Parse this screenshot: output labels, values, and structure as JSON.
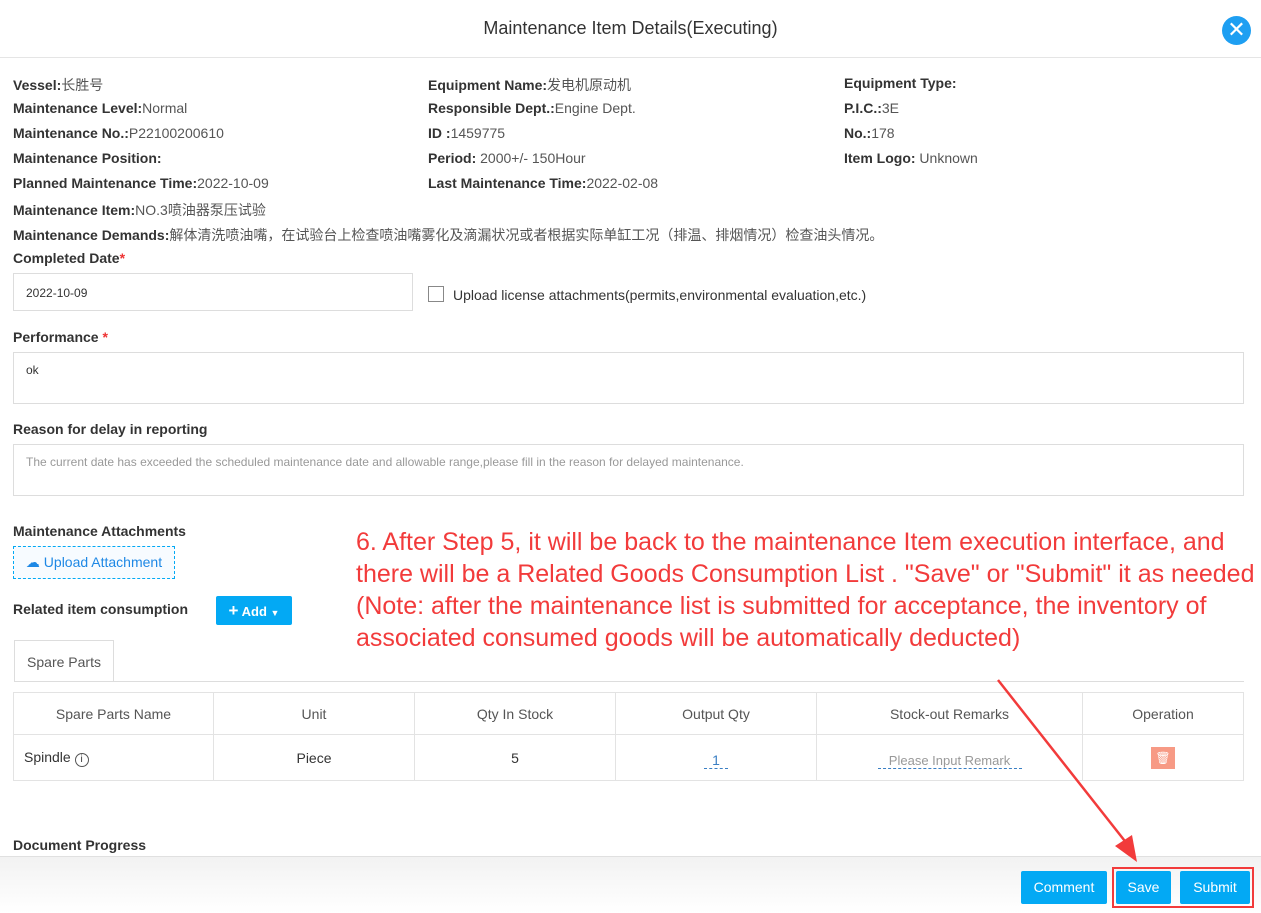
{
  "header": {
    "title": "Maintenance Item Details(Executing)",
    "close_icon": "close-icon"
  },
  "info": [
    {
      "label": "Vessel:",
      "value": "长胜号"
    },
    {
      "label": "Equipment Name:",
      "value": "发电机原动机"
    },
    {
      "label": "Equipment Type:",
      "value": ""
    },
    {
      "label": "Maintenance Level:",
      "value": "Normal"
    },
    {
      "label": "Responsible Dept.:",
      "value": "Engine Dept."
    },
    {
      "label": "P.I.C.:",
      "value": "3E"
    },
    {
      "label": "Maintenance No.:",
      "value": "P22100200610"
    },
    {
      "label": "ID :",
      "value": "1459775"
    },
    {
      "label": "No.:",
      "value": "178"
    },
    {
      "label": "Maintenance Position:",
      "value": ""
    },
    {
      "label": "Period:",
      "value": " 2000+/- 150Hour"
    },
    {
      "label": "Item Logo:",
      "value": " Unknown"
    },
    {
      "label": "Planned Maintenance Time:",
      "value": "2022-10-09"
    },
    {
      "label": "Last Maintenance Time:",
      "value": "2022-02-08"
    },
    {
      "label": "Maintenance Item:",
      "value": "NO.3喷油器泵压试验"
    },
    {
      "label": "Maintenance Demands:",
      "value": "解体清洗喷油嘴，在试验台上检查喷油嘴雾化及滴漏状况或者根据实际单缸工况（排温、排烟情况）检查油头情况。"
    }
  ],
  "form": {
    "completed_date_label": "Completed Date",
    "completed_date": "2022-10-09",
    "upload_license_label": "Upload license attachments(permits,environmental evaluation,etc.)",
    "performance_label": "Performance ",
    "performance": "ok",
    "delay_label": "Reason for delay in reporting",
    "delay_placeholder": "The current date has exceeded the scheduled maintenance date and allowable range,please fill in the reason for delayed maintenance.",
    "attachments_label": "Maintenance Attachments",
    "upload_attachment": "Upload Attachment",
    "consumption_label": "Related item consumption",
    "add_label": "Add",
    "required_mark": "*"
  },
  "tabs": [
    {
      "label": "Spare Parts",
      "active": true
    }
  ],
  "table": {
    "headers": [
      "Spare Parts Name",
      "Unit",
      "Qty In Stock",
      "Output Qty",
      "Stock-out Remarks",
      "Operation"
    ],
    "rows": [
      {
        "name": "Spindle",
        "unit": "Piece",
        "stock": "5",
        "output": "1",
        "remarks_placeholder": "Please Input Remark"
      }
    ]
  },
  "progress_label": "Document Progress",
  "footer": {
    "comment": "Comment",
    "save": "Save",
    "submit": "Submit"
  },
  "annotation": {
    "text": "6. After Step 5, it will be back to the maintenance Item execution interface, and there will be a Related Goods Consumption List . \"Save\" or \"Submit\" it as needed\n(Note: after the maintenance list is submitted for acceptance, the inventory of associated consumed goods will be automatically deducted)",
    "color": "#f23b3b"
  },
  "colors": {
    "primary": "#03a9f4",
    "delete": "#f79a85"
  }
}
